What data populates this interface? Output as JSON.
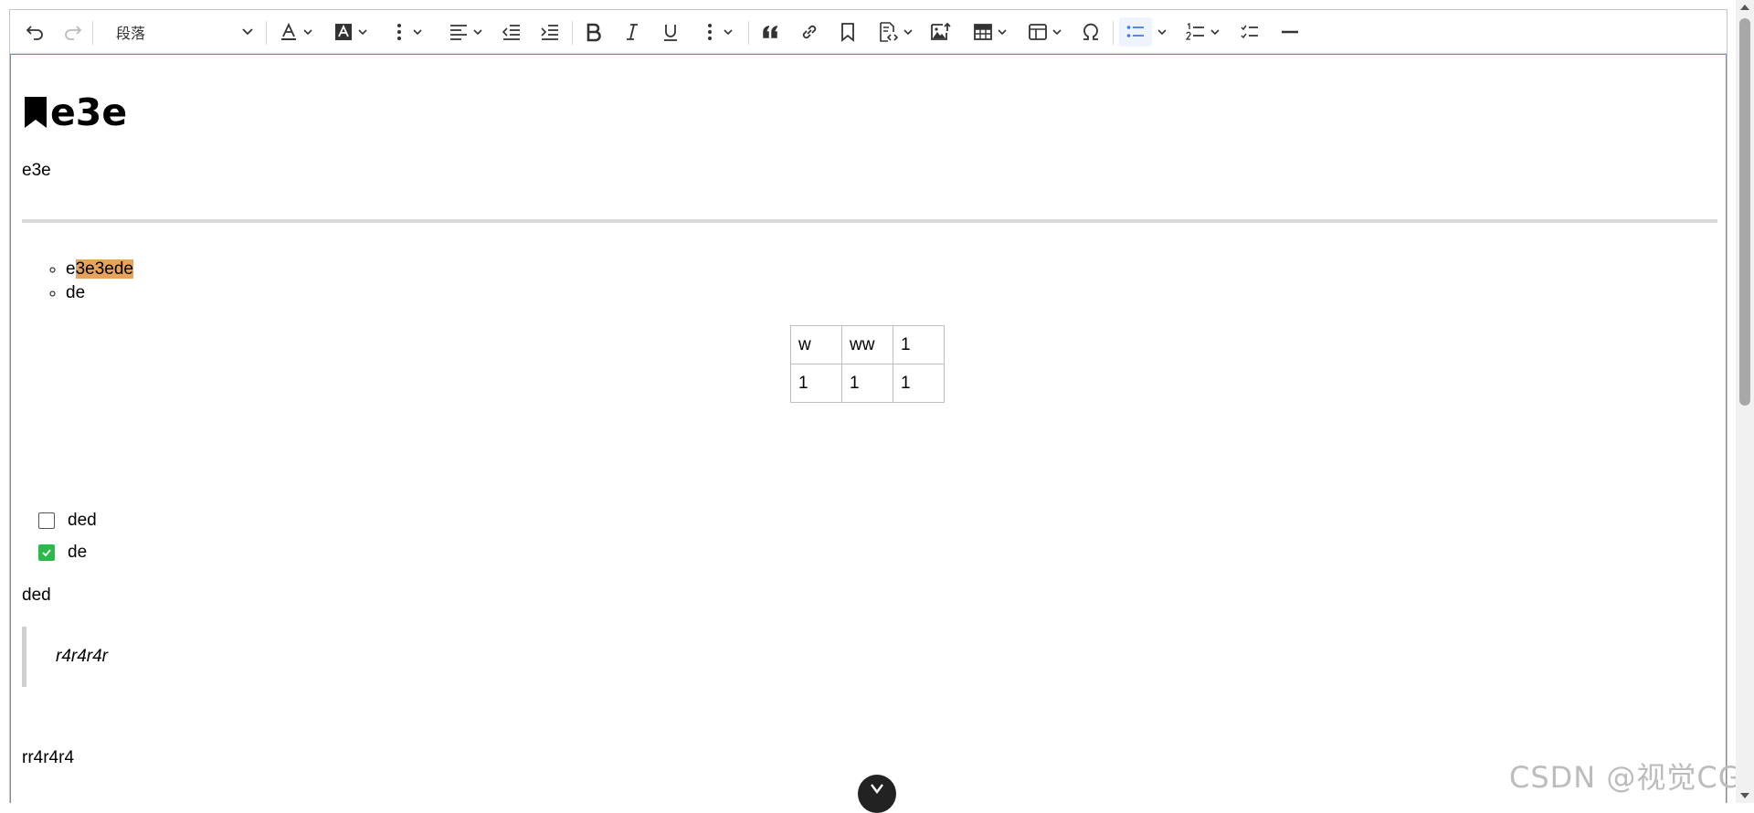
{
  "toolbar": {
    "heading_value": "段落",
    "active_accent": "#3a7df0",
    "icons": [
      "undo-icon",
      "redo-icon",
      "font-color-icon",
      "highlight-icon",
      "more-icon",
      "align-left-icon",
      "outdent-icon",
      "indent-icon",
      "bold-icon",
      "italic-icon",
      "underline-icon",
      "more-icon",
      "blockquote-icon",
      "link-icon",
      "bookmark-icon",
      "code-block-icon",
      "image-upload-icon",
      "table-icon",
      "layout-table-icon",
      "special-char-icon",
      "bulleted-list-icon",
      "numbered-list-icon",
      "todo-list-icon",
      "horizontal-line-icon"
    ]
  },
  "document": {
    "heading": "e3e",
    "para1": "e3e",
    "bullets": [
      {
        "before": "e",
        "highlighted": "3e3ede",
        "highlight_color": "#e6a35e"
      },
      {
        "text": "de"
      }
    ],
    "table": [
      [
        "w",
        "ww",
        "1"
      ],
      [
        "1",
        "1",
        "1"
      ]
    ],
    "todos": [
      {
        "label": "ded",
        "checked": false
      },
      {
        "label": "de",
        "checked": true
      }
    ],
    "para2": "ded",
    "quote": "r4r4r4r",
    "para3": "rr4r4r4"
  },
  "watermark": "CSDN @视觉CG"
}
